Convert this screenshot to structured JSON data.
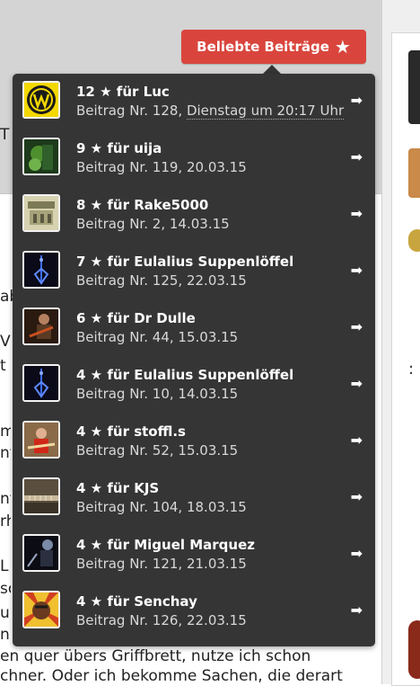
{
  "header": {
    "button_label": "Beliebte Beiträge",
    "button_icon": "star-icon"
  },
  "background_text": {
    "left_letters": [
      "T",
      "ab",
      "V",
      "t",
      "m",
      "nt",
      "nte",
      "rh",
      "L",
      "so",
      "ur",
      "n"
    ],
    "line_1": "en quer übers Griffbrett, nutze ich schon",
    "line_2": "chner. Oder ich bekomme Sachen, die derart"
  },
  "popular_posts": [
    {
      "count": "12",
      "user": "Luc",
      "post_no": "128",
      "date": "Dienstag um 20:17 Uhr",
      "date_dotted": true,
      "avatar": "vw-logo"
    },
    {
      "count": "9",
      "user": "uija",
      "post_no": "119",
      "date": "20.03.15",
      "date_dotted": false,
      "avatar": "green-photo"
    },
    {
      "count": "8",
      "user": "Rake5000",
      "post_no": "2",
      "date": "14.03.15",
      "date_dotted": false,
      "avatar": "building-sign"
    },
    {
      "count": "7",
      "user": "Eulalius Suppenlöffel",
      "post_no": "125",
      "date": "22.03.15",
      "date_dotted": false,
      "avatar": "blue-guitar"
    },
    {
      "count": "6",
      "user": "Dr Dulle",
      "post_no": "44",
      "date": "15.03.15",
      "date_dotted": false,
      "avatar": "guitarist-photo"
    },
    {
      "count": "4",
      "user": "Eulalius Suppenlöffel",
      "post_no": "10",
      "date": "14.03.15",
      "date_dotted": false,
      "avatar": "blue-guitar"
    },
    {
      "count": "4",
      "user": "stoffl.s",
      "post_no": "52",
      "date": "15.03.15",
      "date_dotted": false,
      "avatar": "red-shirt-player"
    },
    {
      "count": "4",
      "user": "KJS",
      "post_no": "104",
      "date": "18.03.15",
      "date_dotted": false,
      "avatar": "guitar-neck"
    },
    {
      "count": "4",
      "user": "Miguel Marquez",
      "post_no": "121",
      "date": "21.03.15",
      "date_dotted": false,
      "avatar": "dark-stage"
    },
    {
      "count": "4",
      "user": "Senchay",
      "post_no": "126",
      "date": "22.03.15",
      "date_dotted": false,
      "avatar": "pop-art-face"
    }
  ],
  "labels": {
    "for": "für",
    "post_prefix": "Beitrag Nr.",
    "separator": ", "
  }
}
